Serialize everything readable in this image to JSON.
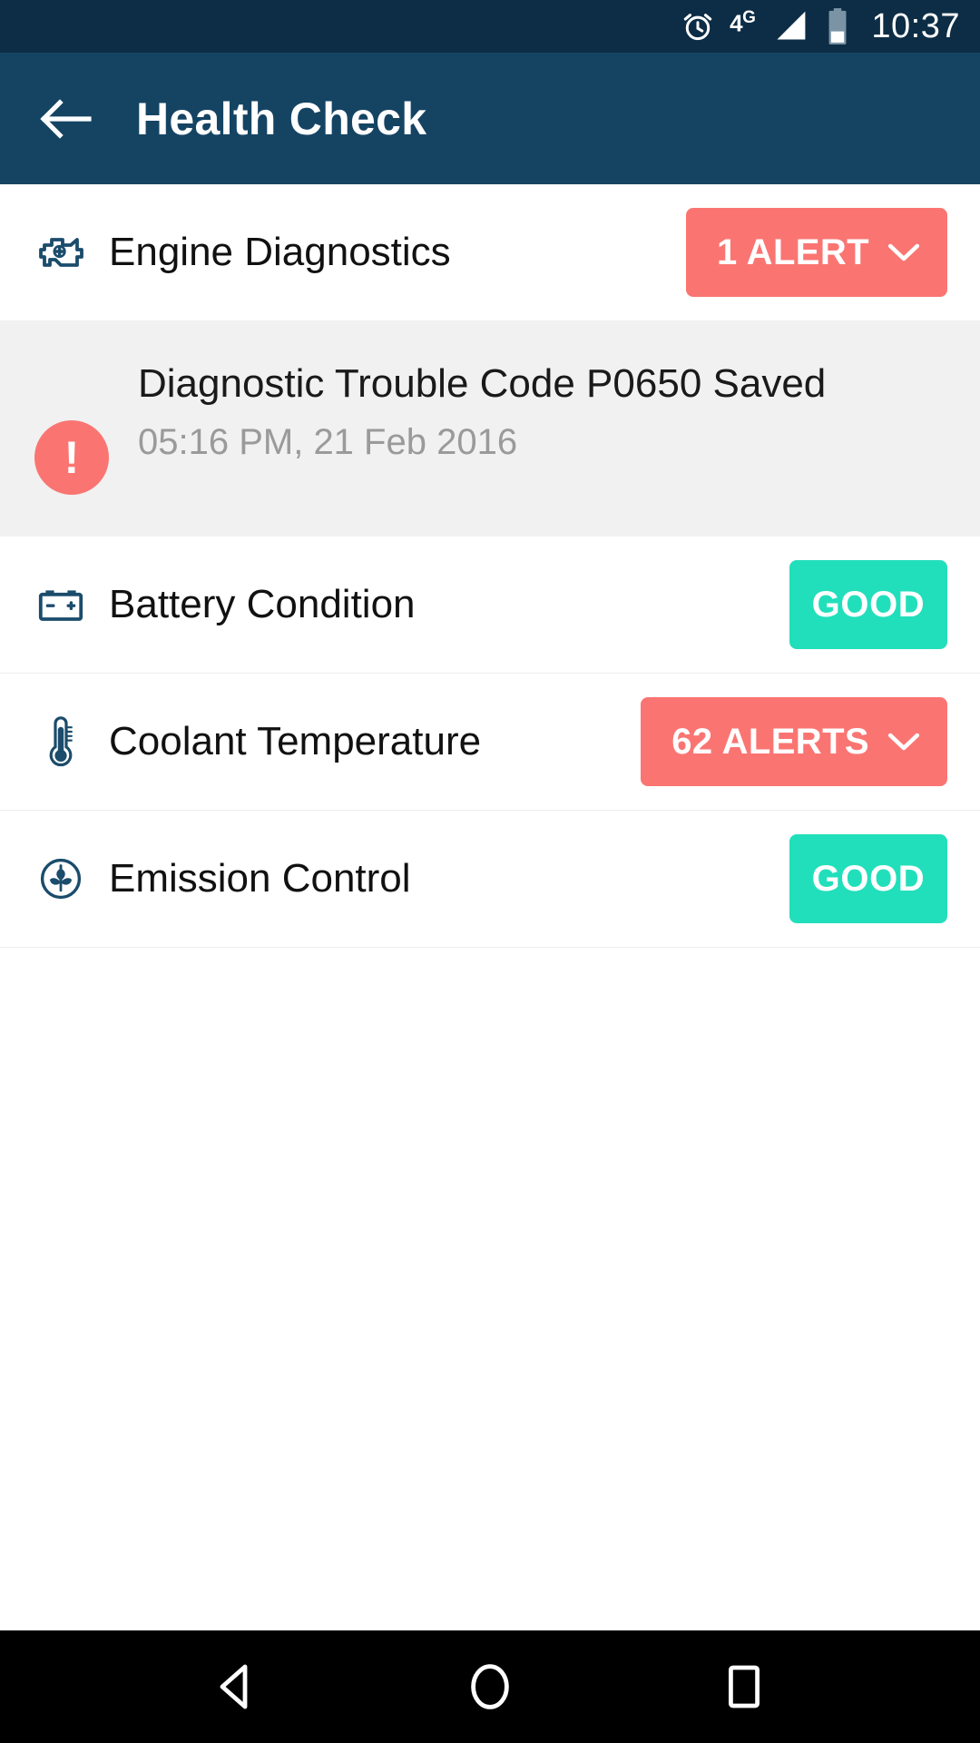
{
  "status_bar": {
    "alarm_icon": "alarm-clock-icon",
    "network": "4G",
    "network_main": "4",
    "network_sup": "G",
    "signal_icon": "signal-bars-icon",
    "battery_icon": "battery-icon",
    "time": "10:37"
  },
  "app_bar": {
    "back_icon": "back-arrow-icon",
    "title": "Health Check"
  },
  "rows": [
    {
      "icon": "engine-check-icon",
      "label": "Engine Diagnostics",
      "badge_label": "1 ALERT",
      "badge_type": "alert",
      "has_chevron": true,
      "expanded": true
    },
    {
      "icon": "car-battery-icon",
      "label": "Battery Condition",
      "badge_label": "GOOD",
      "badge_type": "good",
      "has_chevron": false,
      "expanded": false
    },
    {
      "icon": "thermometer-icon",
      "label": "Coolant Temperature",
      "badge_label": "62 ALERTS",
      "badge_type": "alert",
      "has_chevron": true,
      "expanded": false
    },
    {
      "icon": "emission-leaf-icon",
      "label": "Emission Control",
      "badge_label": "GOOD",
      "badge_type": "good",
      "has_chevron": false,
      "expanded": false
    }
  ],
  "alert_detail": {
    "bullet": "!",
    "title": "Diagnostic Trouble Code P0650 Saved",
    "timestamp": "05:16 PM, 21 Feb 2016"
  },
  "nav_bar": {
    "back": "nav-back-icon",
    "home": "nav-home-icon",
    "recents": "nav-recents-icon"
  },
  "colors": {
    "status_bar": "#0c2d45",
    "app_bar": "#154463",
    "alert_badge": "#fa7572",
    "good_badge": "#22dfbb",
    "panel_bg": "#f1f1f1",
    "icon_navy": "#1b4c6b"
  }
}
